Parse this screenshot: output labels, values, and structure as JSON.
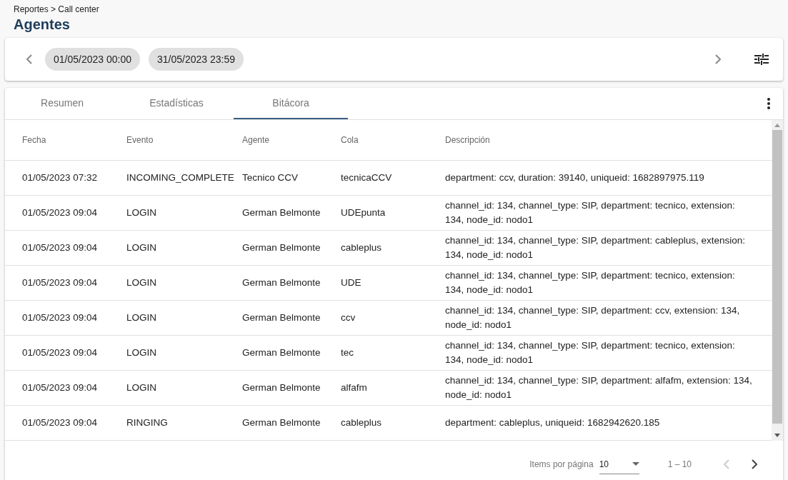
{
  "breadcrumb": "Reportes > Call center",
  "title": "Agentes",
  "date_range": {
    "start": "01/05/2023 00:00",
    "end": "31/05/2023 23:59"
  },
  "tabs": [
    {
      "label": "Resumen",
      "selected": false
    },
    {
      "label": "Estadísticas",
      "selected": false
    },
    {
      "label": "Bitácora",
      "selected": true
    }
  ],
  "table": {
    "columns": [
      "Fecha",
      "Evento",
      "Agente",
      "Cola",
      "Descripción"
    ],
    "rows": [
      [
        "01/05/2023 07:32",
        "INCOMING_COMPLETE",
        "Tecnico CCV",
        "tecnicaCCV",
        "department: ccv, duration: 39140, uniqueid: 1682897975.119"
      ],
      [
        "01/05/2023 09:04",
        "LOGIN",
        "German Belmonte",
        "UDEpunta",
        "channel_id: 134, channel_type: SIP, department: tecnico, extension: 134, node_id: nodo1"
      ],
      [
        "01/05/2023 09:04",
        "LOGIN",
        "German Belmonte",
        "cableplus",
        "channel_id: 134, channel_type: SIP, department: cableplus, extension: 134, node_id: nodo1"
      ],
      [
        "01/05/2023 09:04",
        "LOGIN",
        "German Belmonte",
        "UDE",
        "channel_id: 134, channel_type: SIP, department: tecnico, extension: 134, node_id: nodo1"
      ],
      [
        "01/05/2023 09:04",
        "LOGIN",
        "German Belmonte",
        "ccv",
        "channel_id: 134, channel_type: SIP, department: ccv, extension: 134, node_id: nodo1"
      ],
      [
        "01/05/2023 09:04",
        "LOGIN",
        "German Belmonte",
        "tec",
        "channel_id: 134, channel_type: SIP, department: tecnico, extension: 134, node_id: nodo1"
      ],
      [
        "01/05/2023 09:04",
        "LOGIN",
        "German Belmonte",
        "alfafm",
        "channel_id: 134, channel_type: SIP, department: alfafm, extension: 134, node_id: nodo1"
      ],
      [
        "01/05/2023 09:04",
        "RINGING",
        "German Belmonte",
        "cableplus",
        "department: cableplus, uniqueid: 1682942620.185"
      ]
    ]
  },
  "paginator": {
    "label": "Items por página",
    "page_size": "10",
    "range": "1 – 10",
    "previous_disabled": true,
    "next_disabled": false
  }
}
